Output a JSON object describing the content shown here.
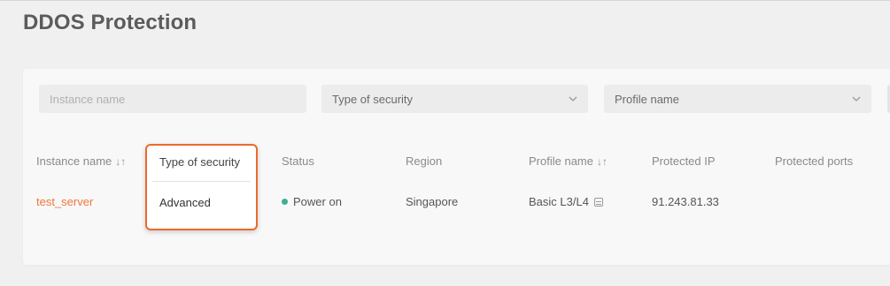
{
  "page": {
    "title": "DDOS Protection"
  },
  "filters": {
    "instance_placeholder": "Instance name",
    "security_type": {
      "label": "Type of security",
      "icon": "chevron-down-icon"
    },
    "profile_name": {
      "label": "Profile name",
      "icon": "chevron-down-icon"
    }
  },
  "table": {
    "headers": {
      "instance": "Instance name",
      "instance_sort": "↓↑",
      "security": "Type of security",
      "status": "Status",
      "region": "Region",
      "profile": "Profile name",
      "profile_sort": "↓↑",
      "ip": "Protected IP",
      "ports": "Protected ports"
    },
    "rows": [
      {
        "instance": "test_server",
        "security": "Advanced",
        "status": "Power on",
        "region": "Singapore",
        "profile": "Basic L3/L4",
        "ip": "91.243.81.33",
        "ports": ""
      }
    ]
  },
  "colors": {
    "link": "#f0763b",
    "status_on": "#3fae95",
    "highlight_border": "#ec6a2c"
  }
}
